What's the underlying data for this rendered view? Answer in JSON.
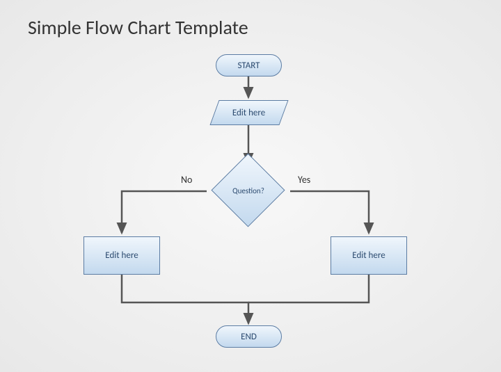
{
  "title": "Simple Flow Chart Template",
  "nodes": {
    "start": "START",
    "input": "Edit here",
    "decision": "Question?",
    "no_label": "No",
    "yes_label": "Yes",
    "left_process": "Edit here",
    "right_process": "Edit here",
    "end": "END"
  },
  "colors": {
    "shape_fill_top": "#f0f6fc",
    "shape_fill_bottom": "#c3d9ee",
    "shape_border": "#5b7ca3",
    "connector": "#555555",
    "text": "#2b4a6f"
  }
}
